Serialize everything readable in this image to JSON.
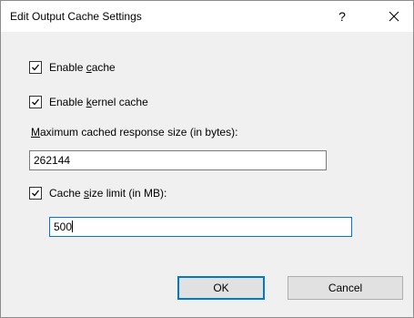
{
  "dialog": {
    "title": "Edit Output Cache Settings",
    "help_label": "?"
  },
  "enable_cache": {
    "checked": true,
    "label_pre": "Enable ",
    "label_accel": "c",
    "label_post": "ache"
  },
  "enable_kernel_cache": {
    "checked": true,
    "label_pre": "Enable ",
    "label_accel": "k",
    "label_post": "ernel cache"
  },
  "max_response_size": {
    "label_accel": "M",
    "label_post": "aximum cached response size (in bytes):",
    "value": "262144"
  },
  "cache_size_limit": {
    "checked": true,
    "label_pre": "Cache ",
    "label_accel": "s",
    "label_post": "ize limit (in MB):",
    "value": "500"
  },
  "buttons": {
    "ok": "OK",
    "cancel": "Cancel"
  },
  "colors": {
    "accent": "#0078d7",
    "titlebar": "#ffffff",
    "body": "#f0f0f0"
  }
}
